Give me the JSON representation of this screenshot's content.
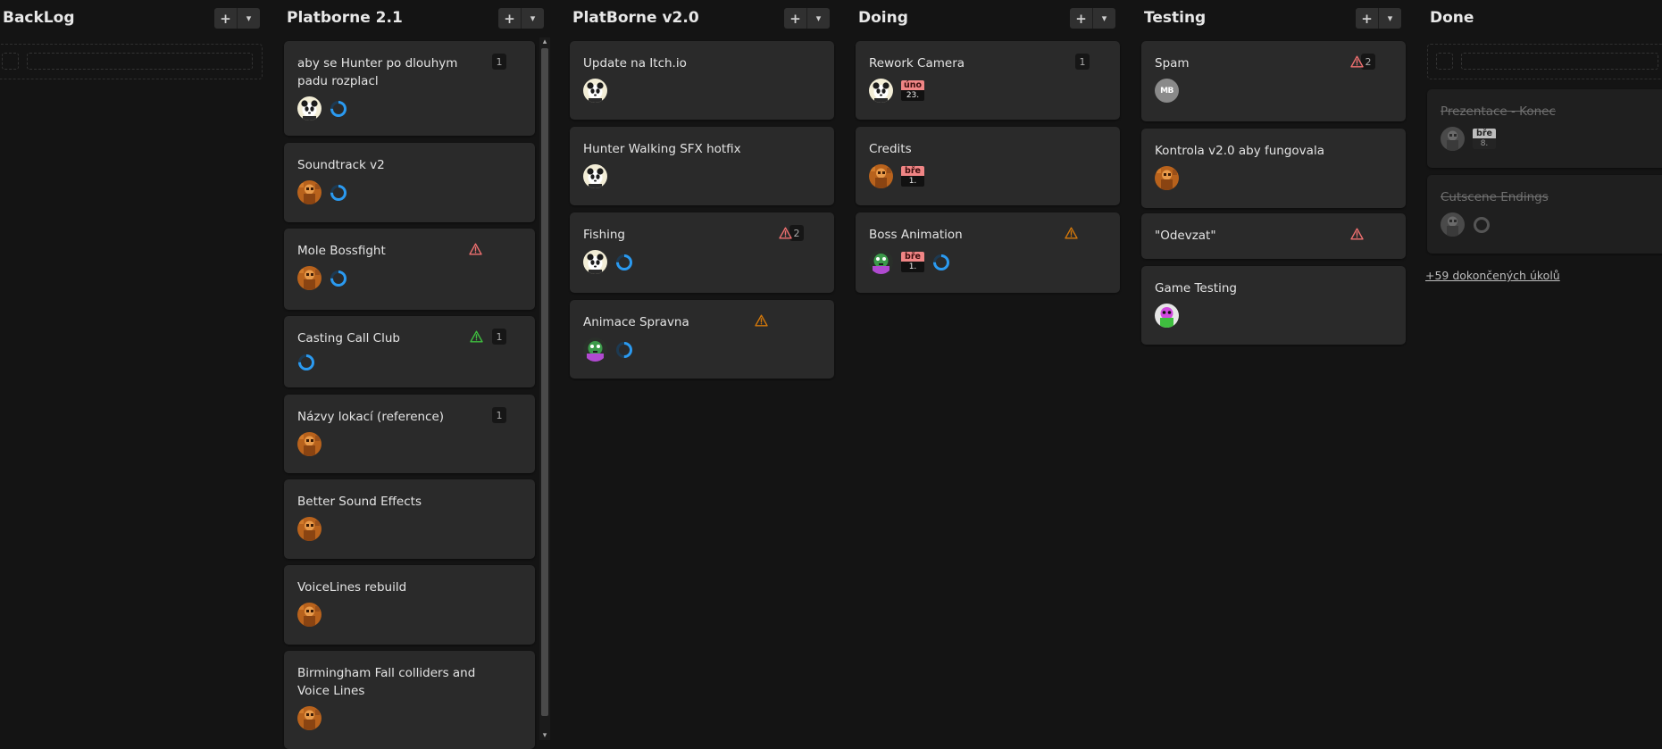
{
  "colors": {
    "background": "#141414",
    "card": "#2a2a2a",
    "warning_red": "#f07070",
    "warning_orange": "#d4780a",
    "warning_green": "#3fbf3f",
    "progress_blue": "#2b9af0",
    "date_red": "#f08585"
  },
  "columns": [
    {
      "title": "BackLog",
      "add_icon": "+",
      "menu_icon": "▾",
      "cards": []
    },
    {
      "title": "Platborne 2.1",
      "add_icon": "+",
      "menu_icon": "▾",
      "cards": [
        {
          "title": "aby se Hunter po dlouhym padu rozplacl",
          "badge": "1",
          "assignee": "panda-avatar",
          "progress": 0.75
        },
        {
          "title": "Soundtrack v2",
          "assignee": "orange-avatar",
          "progress": 0.75
        },
        {
          "title": "Mole Bossfight",
          "warning": "red",
          "assignee": "orange-avatar",
          "progress": 0.75
        },
        {
          "title": "Casting Call Club",
          "badge": "1",
          "warning": "green",
          "progress": 0.75
        },
        {
          "title": "Názvy lokací (reference)",
          "badge": "1",
          "assignee": "orange-avatar"
        },
        {
          "title": "Better Sound Effects",
          "assignee": "orange-avatar"
        },
        {
          "title": "VoiceLines rebuild",
          "assignee": "orange-avatar"
        },
        {
          "title": "Birmingham Fall colliders and Voice Lines",
          "assignee": "orange-avatar"
        }
      ]
    },
    {
      "title": "PlatBorne v2.0",
      "add_icon": "+",
      "menu_icon": "▾",
      "cards": [
        {
          "title": "Update na Itch.io",
          "assignee": "panda-avatar"
        },
        {
          "title": "Hunter Walking SFX hotfix",
          "assignee": "panda-avatar"
        },
        {
          "title": "Fishing",
          "badge": "2",
          "warning": "red",
          "assignee": "panda-avatar",
          "progress": 0.75
        },
        {
          "title": "Animace Spravna",
          "warning": "orange",
          "assignee": "monster-avatar",
          "progress": 0.5
        }
      ]
    },
    {
      "title": "Doing",
      "add_icon": "+",
      "menu_icon": "▾",
      "cards": [
        {
          "title": "Rework Camera",
          "badge": "1",
          "assignee": "panda-avatar",
          "date_month": "úno",
          "date_day": "23."
        },
        {
          "title": "Credits",
          "assignee": "orange-avatar",
          "date_month": "bře",
          "date_day": "1."
        },
        {
          "title": "Boss Animation",
          "warning": "orange",
          "assignee": "monster-avatar",
          "date_month": "bře",
          "date_day": "1.",
          "progress": 0.75
        }
      ]
    },
    {
      "title": "Testing",
      "add_icon": "+",
      "menu_icon": "▾",
      "cards": [
        {
          "title": "Spam",
          "badge": "2",
          "warning": "red",
          "assignee_initials": "MB"
        },
        {
          "title": "Kontrola v2.0 aby fungovala",
          "assignee": "orange-avatar"
        },
        {
          "title": "\"Odevzat\"",
          "warning": "red"
        },
        {
          "title": "Game Testing",
          "assignee": "green-avatar"
        }
      ]
    },
    {
      "title": "Done",
      "cards": [
        {
          "title": "Prezentace - Konec",
          "assignee": "gray-avatar",
          "date_month": "bře",
          "date_day": "8."
        },
        {
          "title": "Cutscene Endings",
          "assignee": "gray-avatar",
          "progress": 0
        }
      ],
      "more_link": "+59 dokončených úkolů"
    }
  ],
  "scrollbar": {
    "up_icon": "▴",
    "down_icon": "▾"
  }
}
